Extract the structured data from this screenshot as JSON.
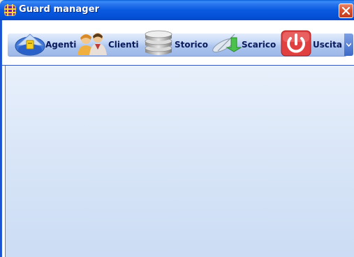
{
  "window": {
    "title": "Guard manager",
    "icon": "guard-app-icon",
    "controls": [
      "close-icon"
    ]
  },
  "toolbar": {
    "items": [
      {
        "label": "Agenti",
        "icon": "agent-badge-icon"
      },
      {
        "label": "Clienti",
        "icon": "clients-people-icon"
      },
      {
        "label": "Storico",
        "icon": "database-stack-icon"
      },
      {
        "label": "Scarico",
        "icon": "satellite-download-icon"
      },
      {
        "label": "Uscita",
        "icon": "power-icon"
      }
    ],
    "overflow_icon": "chevron-down-icon"
  },
  "colors": {
    "titlebar": "#0a5ae0",
    "close_button": "#d65434",
    "toolbar_band": "#c9daf6",
    "content_background": "#dbe7f8",
    "label_text": "#0a1a5a"
  }
}
